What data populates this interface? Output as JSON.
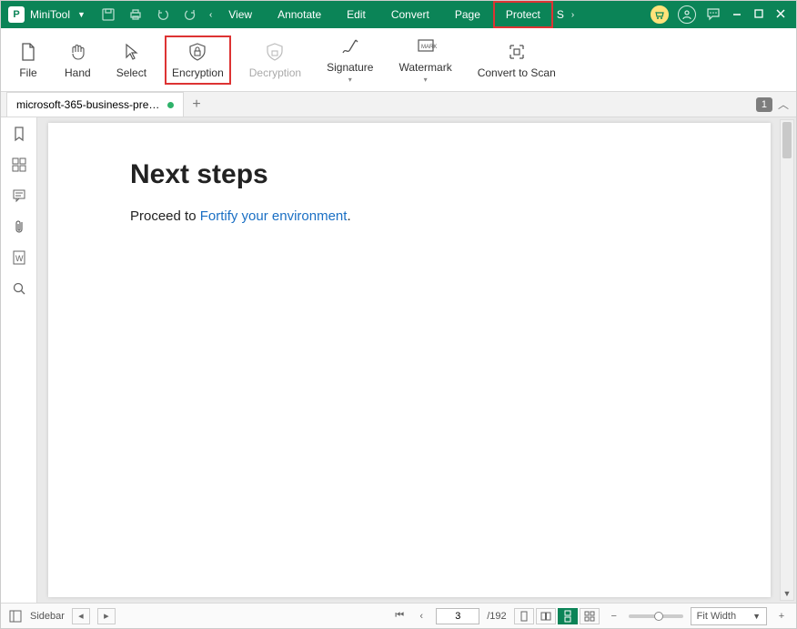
{
  "brand": {
    "name": "MiniTool"
  },
  "menus": {
    "view": "View",
    "annotate": "Annotate",
    "edit": "Edit",
    "convert": "Convert",
    "page": "Page",
    "protect": "Protect",
    "share_initial": "S"
  },
  "ribbon": {
    "file": "File",
    "hand": "Hand",
    "select": "Select",
    "encryption": "Encryption",
    "decryption": "Decryption",
    "signature": "Signature",
    "watermark": "Watermark",
    "convert_to_scan": "Convert to Scan"
  },
  "tab": {
    "title": "microsoft-365-business-premi..."
  },
  "tabstrip": {
    "badge": "1"
  },
  "document": {
    "heading": "Next steps",
    "body_prefix": "Proceed to ",
    "link_text": "Fortify your environment",
    "body_suffix": "."
  },
  "status": {
    "sidebar_label": "Sidebar",
    "current_page": "3",
    "total_pages": "/192",
    "fit_label": "Fit Width"
  }
}
